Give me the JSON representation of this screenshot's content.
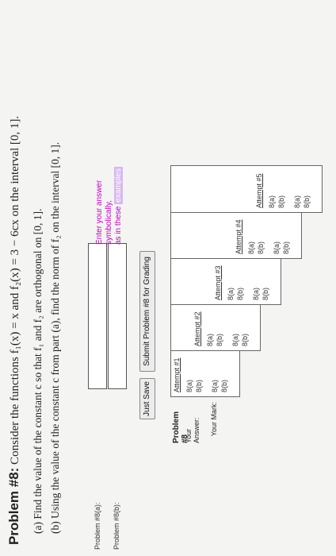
{
  "problem": {
    "heading": "Problem #8:",
    "statement": "Consider the functions f₁(x) = x and f₂(x) = 3 − 6cx on the interval [0, 1].",
    "part_a": "(a) Find the value of the constant c so that f₁ and f₂ are orthogonal on [0, 1].",
    "part_b": "(b) Using the value of the constant c from part (a), find the norm of f₂ on the interval [0, 1]."
  },
  "answers": {
    "a_label": "Problem #8(a):",
    "b_label": "Problem #8(b):",
    "a_value": "",
    "b_value": ""
  },
  "hint": {
    "line1": "Enter your answer symbolically,",
    "line2_prefix": "as in these",
    "examples_link": "examples"
  },
  "buttons": {
    "just_save": "Just Save",
    "submit": "Submit Problem #8 for Grading"
  },
  "attempts_table": {
    "row_header": "Problem #8",
    "your_answer_label": "Your Answer:",
    "your_mark_label": "Your Mark:",
    "attempts": [
      {
        "header": "Attempt #1",
        "answers": [
          "8(a)",
          "8(b)"
        ],
        "marks": [
          "8(a)",
          "8(b)"
        ]
      },
      {
        "header": "Attempt #2",
        "answers": [
          "8(a)",
          "8(b)"
        ],
        "marks": [
          "8(a)",
          "8(b)"
        ]
      },
      {
        "header": "Attempt #3",
        "answers": [
          "8(a)",
          "8(b)"
        ],
        "marks": [
          "8(a)",
          "8(b)"
        ]
      },
      {
        "header": "Attempt #4",
        "answers": [
          "8(a)",
          "8(b)"
        ],
        "marks": [
          "8(a)",
          "8(b)"
        ]
      },
      {
        "header": "Attempt #5",
        "answers": [
          "8(a)",
          "8(b)"
        ],
        "marks": [
          "8(a)",
          "8(b)"
        ]
      }
    ]
  },
  "colors": {
    "hint_text": "#c100c1",
    "examples_highlight": "#d9b8f0"
  }
}
